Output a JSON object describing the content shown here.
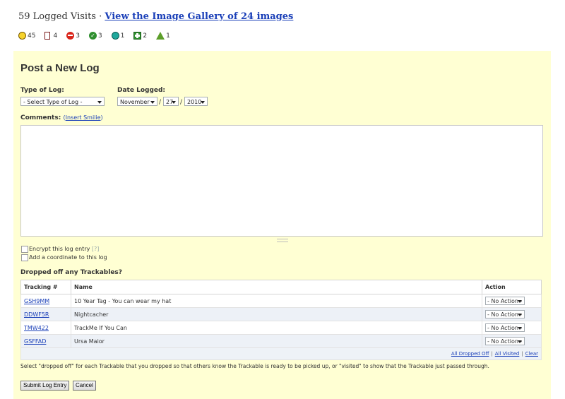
{
  "header": {
    "visits_text": "59 Logged Visits",
    "separator": " · ",
    "gallery_link": "View the Image Gallery of 24 images"
  },
  "stats": [
    {
      "icon": "smile-icon",
      "count": "45"
    },
    {
      "icon": "note-icon",
      "count": "4"
    },
    {
      "icon": "do-not-enter-icon",
      "count": "3"
    },
    {
      "icon": "check-icon",
      "count": "3"
    },
    {
      "icon": "globe-icon",
      "count": "1"
    },
    {
      "icon": "green-cross-icon",
      "count": "2"
    },
    {
      "icon": "tree-icon",
      "count": "1"
    }
  ],
  "form": {
    "title": "Post a New Log",
    "type_label": "Type of Log:",
    "type_value": "- Select Type of Log -",
    "date_label": "Date Logged:",
    "month": "November",
    "day": "27",
    "year": "2010",
    "comments_label": "Comments:",
    "insert_smilie": "Insert Smilie",
    "encrypt_label": "Encrypt this log entry",
    "encrypt_help": "[?]",
    "coord_label": "Add a coordinate to this log"
  },
  "trackables": {
    "heading": "Dropped off any Trackables?",
    "columns": [
      "Tracking #",
      "Name",
      "Action"
    ],
    "rows": [
      {
        "code": "GSH9MM",
        "name": "10 Year Tag - You can wear my hat",
        "action": "- No Action -"
      },
      {
        "code": "DDWF5R",
        "name": "Nightcacher",
        "action": "- No Action -"
      },
      {
        "code": "TMW422",
        "name": "TrackMe If You Can",
        "action": "- No Action -"
      },
      {
        "code": "GSFFAD",
        "name": "Ursa Maior",
        "action": "- No Action -"
      }
    ],
    "footer_links": [
      "All Dropped Off",
      "All Visited",
      "Clear"
    ]
  },
  "note": "Select \"dropped off\" for each Trackable that you dropped so that others know the Trackable is ready to be picked up, or \"visited\" to show that the Trackable just passed through.",
  "buttons": {
    "submit": "Submit Log Entry",
    "cancel": "Cancel"
  }
}
